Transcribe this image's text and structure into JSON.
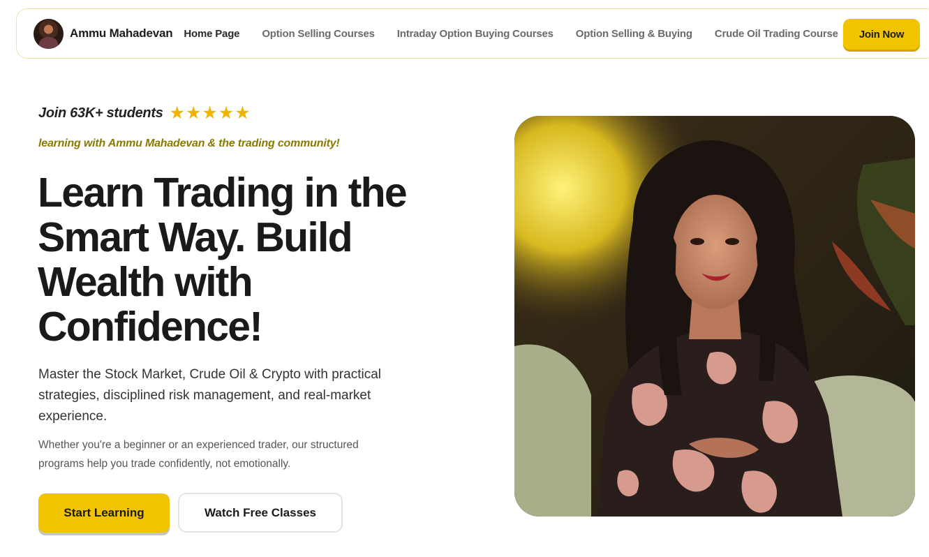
{
  "nav": {
    "brand_name": "Ammu Mahadevan",
    "links": [
      "Home Page",
      "Option Selling Courses",
      "Intraday Option Buying Courses",
      "Option Selling & Buying",
      "Crude Oil Trading Course"
    ],
    "join_label": "Join Now",
    "accent": "#f2c300"
  },
  "hero": {
    "join_text": "Join 63K+ students",
    "stars": [
      "★",
      "★",
      "★",
      "★",
      "★"
    ],
    "subline": "learning with Ammu Mahadevan & the trading community!",
    "headline": "Learn Trading in the Smart Way. Build Wealth with Confidence!",
    "description": "Master the Stock Market, Crude Oil & Crypto with practical strategies, disciplined risk management, and real-market experience.",
    "description_small": "Whether you're a beginner or an experienced trader, our structured programs help you trade confidently, not emotionally.",
    "primary_cta": "Start Learning",
    "secondary_cta": "Watch Free Classes"
  }
}
